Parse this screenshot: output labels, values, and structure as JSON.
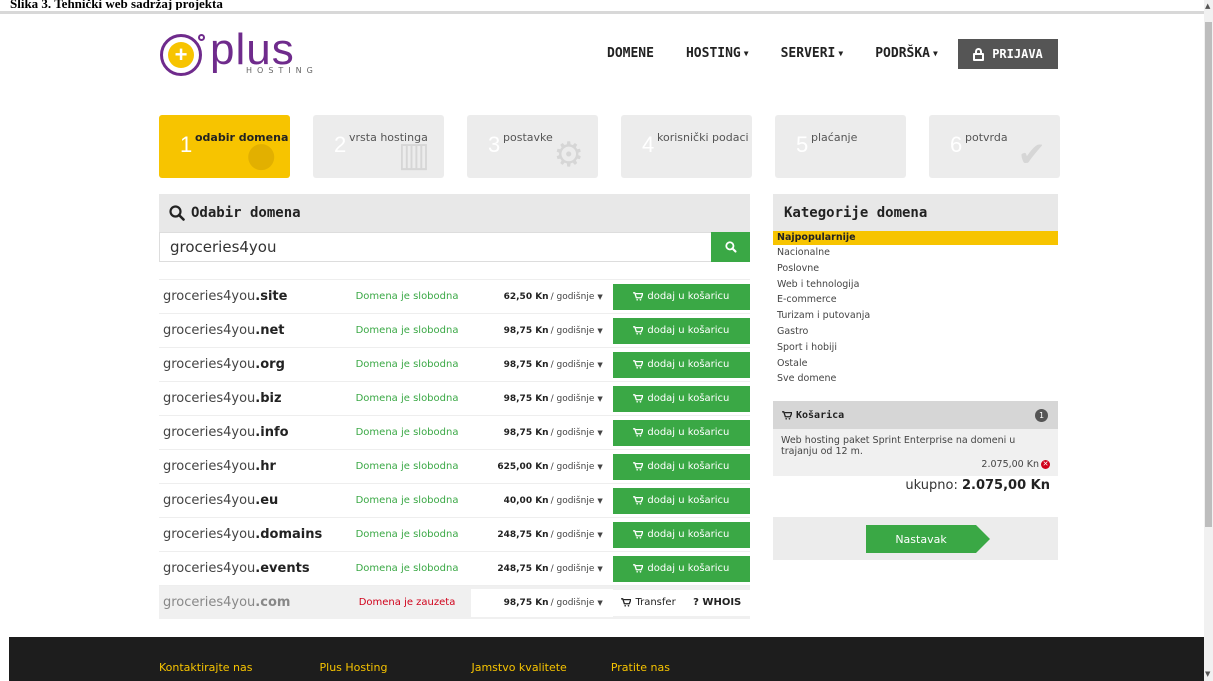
{
  "caption": "Slika 3. Tehnički web sadržaj projekta",
  "header": {
    "logo_word": "plus",
    "logo_sub": "HOSTING",
    "nav": [
      {
        "label": "DOMENE",
        "dropdown": false
      },
      {
        "label": "HOSTING",
        "dropdown": true
      },
      {
        "label": "SERVERI",
        "dropdown": true
      },
      {
        "label": "PODRŠKA",
        "dropdown": true
      }
    ],
    "login_label": "PRIJAVA"
  },
  "steps": [
    {
      "num": "1",
      "label": "odabir domena",
      "active": true,
      "icon": "globe-icon"
    },
    {
      "num": "2",
      "label": "vrsta hostinga",
      "active": false,
      "icon": "server-icon"
    },
    {
      "num": "3",
      "label": "postavke",
      "active": false,
      "icon": "gears-icon"
    },
    {
      "num": "4",
      "label": "korisnički podaci",
      "active": false,
      "icon": "user-icon"
    },
    {
      "num": "5",
      "label": "plaćanje",
      "active": false,
      "icon": "payment-icon"
    },
    {
      "num": "6",
      "label": "potvrda",
      "active": false,
      "icon": "check-icon"
    }
  ],
  "search": {
    "title": "Odabir domena",
    "value": "groceries4you"
  },
  "results": [
    {
      "base": "groceries4you",
      "tld": ".site",
      "status": "Domena je slobodna",
      "price": "62,50 Kn",
      "period": "/ godišnje",
      "taken": false
    },
    {
      "base": "groceries4you",
      "tld": ".net",
      "status": "Domena je slobodna",
      "price": "98,75 Kn",
      "period": "/ godišnje",
      "taken": false
    },
    {
      "base": "groceries4you",
      "tld": ".org",
      "status": "Domena je slobodna",
      "price": "98,75 Kn",
      "period": "/ godišnje",
      "taken": false
    },
    {
      "base": "groceries4you",
      "tld": ".biz",
      "status": "Domena je slobodna",
      "price": "98,75 Kn",
      "period": "/ godišnje",
      "taken": false
    },
    {
      "base": "groceries4you",
      "tld": ".info",
      "status": "Domena je slobodna",
      "price": "98,75 Kn",
      "period": "/ godišnje",
      "taken": false
    },
    {
      "base": "groceries4you",
      "tld": ".hr",
      "status": "Domena je slobodna",
      "price": "625,00 Kn",
      "period": "/ godišnje",
      "taken": false
    },
    {
      "base": "groceries4you",
      "tld": ".eu",
      "status": "Domena je slobodna",
      "price": "40,00 Kn",
      "period": "/ godišnje",
      "taken": false
    },
    {
      "base": "groceries4you",
      "tld": ".domains",
      "status": "Domena je slobodna",
      "price": "248,75 Kn",
      "period": "/ godišnje",
      "taken": false
    },
    {
      "base": "groceries4you",
      "tld": ".events",
      "status": "Domena je slobodna",
      "price": "248,75 Kn",
      "period": "/ godišnje",
      "taken": false
    },
    {
      "base": "groceries4you",
      "tld": ".com",
      "status": "Domena je zauzeta",
      "price": "98,75 Kn",
      "period": "/ godišnje",
      "taken": true
    }
  ],
  "add_label": "dodaj u košaricu",
  "transfer_label": "Transfer",
  "whois_label": "? WHOIS",
  "categories": {
    "title": "Kategorije domena",
    "items": [
      "Najpopularnije",
      "Nacionalne",
      "Poslovne",
      "Web i tehnologija",
      "E-commerce",
      "Turizam i putovanja",
      "Gastro",
      "Sport i hobiji",
      "Ostale",
      "Sve domene"
    ]
  },
  "cart": {
    "title": "Košarica",
    "count": "1",
    "item_desc": "Web hosting paket Sprint Enterprise na domeni u trajanju od 12 m.",
    "item_price": "2.075,00 Kn",
    "total_label": "ukupno:",
    "total_value": "2.075,00 Kn"
  },
  "continue_label": "Nastavak",
  "footer": {
    "links": [
      "Kontaktirajte nas",
      "Plus Hosting",
      "Jamstvo kvalitete",
      "Pratite nas"
    ]
  },
  "colors": {
    "brand_purple": "#6f2b8c",
    "accent_yellow": "#f7c400",
    "action_green": "#3aa845",
    "error_red": "#d0021b"
  }
}
